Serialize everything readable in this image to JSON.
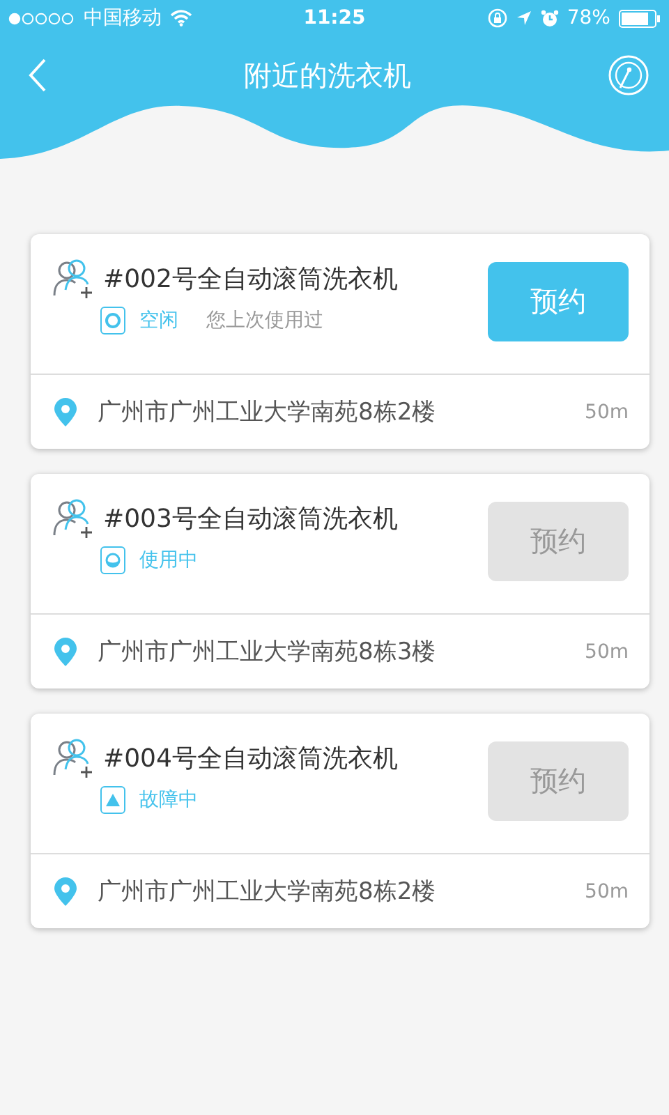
{
  "status_bar": {
    "carrier": "中国移动",
    "time": "11:25",
    "battery": "78%"
  },
  "header": {
    "title": "附近的洗衣机"
  },
  "machines": [
    {
      "name": "#002号全自动滚筒洗衣机",
      "status": {
        "kind": "idle",
        "label": "空闲"
      },
      "note": "您上次使用过",
      "button": {
        "label": "预约",
        "disabled": false
      },
      "address": "广州市广州工业大学南苑8栋2楼",
      "distance": "50m"
    },
    {
      "name": "#003号全自动滚筒洗衣机",
      "status": {
        "kind": "in_use",
        "label": "使用中"
      },
      "button": {
        "label": "预约",
        "disabled": true
      },
      "address": "广州市广州工业大学南苑8栋3楼",
      "distance": "50m"
    },
    {
      "name": "#004号全自动滚筒洗衣机",
      "status": {
        "kind": "fault",
        "label": "故障中"
      },
      "button": {
        "label": "预约",
        "disabled": true
      },
      "address": "广州市广州工业大学南苑8栋2楼",
      "distance": "50m"
    }
  ]
}
